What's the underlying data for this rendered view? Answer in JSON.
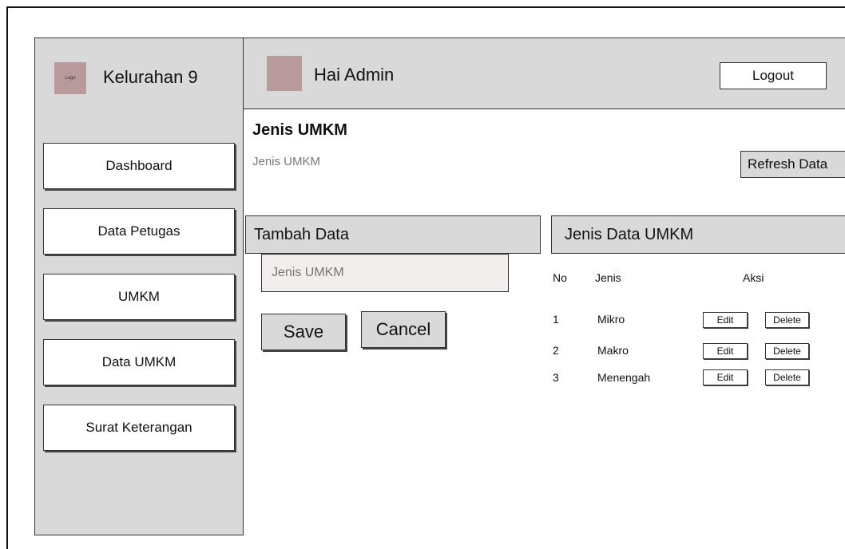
{
  "sidebar": {
    "logo_text": "Logo",
    "brand": "Kelurahan 9",
    "items": [
      {
        "label": "Dashboard"
      },
      {
        "label": "Data Petugas"
      },
      {
        "label": "UMKM"
      },
      {
        "label": "Data UMKM"
      },
      {
        "label": "Surat Keterangan"
      }
    ]
  },
  "header": {
    "greeting": "Hai Admin",
    "logout_label": "Logout"
  },
  "page": {
    "title": "Jenis UMKM",
    "breadcrumb": "Jenis UMKM",
    "refresh_label": "Refresh Data"
  },
  "form": {
    "heading": "Tambah Data",
    "input_placeholder": "Jenis UMKM",
    "save_label": "Save",
    "cancel_label": "Cancel"
  },
  "table": {
    "heading": "Jenis Data UMKM",
    "columns": [
      "No",
      "Jenis",
      "Aksi"
    ],
    "rows": [
      {
        "no": "1",
        "jenis": "Mikro",
        "edit": "Edit",
        "delete": "Delete"
      },
      {
        "no": "2",
        "jenis": "Makro",
        "edit": "Edit",
        "delete": "Delete"
      },
      {
        "no": "3",
        "jenis": "Menengah",
        "edit": "Edit",
        "delete": "Delete"
      }
    ]
  },
  "colors": {
    "panel_gray": "#d9d9d9",
    "logo_mauve": "#b89a9c"
  }
}
